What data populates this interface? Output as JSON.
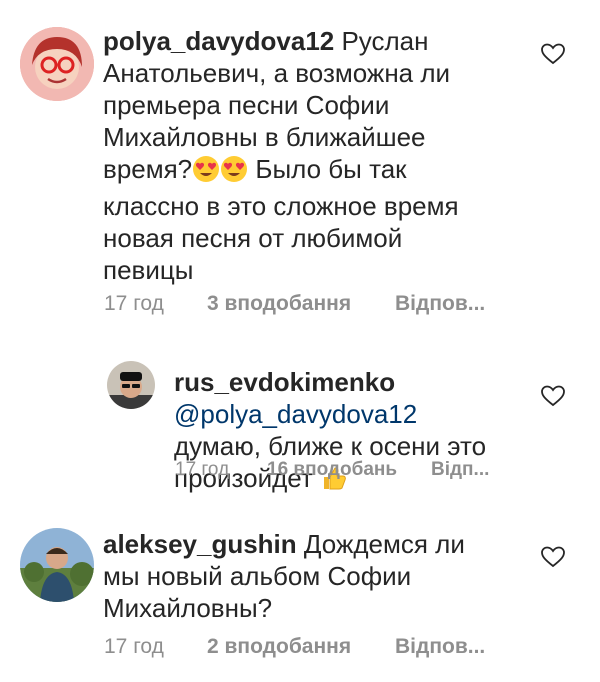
{
  "comments": [
    {
      "username": "polya_davydova12",
      "text_before": " Руслан Анатольевич,  а возможна ли премьера песни Софии Михайловны в ближайшее время?",
      "emoji": "heart-eyes-emoji heart-eyes-emoji",
      "text_after": " Было бы так классно в это сложное время новая песня от любимой певицы",
      "time": "17 год",
      "likes": "3 вподобання",
      "reply": "Відпов..."
    },
    {
      "username": "rus_evdokimenko",
      "mention": "@polya_davydova12",
      "text": " думаю, ближе к осени это произойдет ",
      "emoji": "thumbs-up-emoji",
      "time": "17 год",
      "likes": "16 вподобань",
      "reply": "Відп..."
    },
    {
      "username": "aleksey_gushin",
      "text": " Дождемся ли мы новый альбом Софии Михайловны?",
      "time": "17 год",
      "likes": "2 вподобання",
      "reply": "Відпов..."
    }
  ],
  "icons": {
    "like": "heart-outline-icon",
    "avatar": "avatar"
  },
  "colors": {
    "text": "#262626",
    "meta": "#8e8e8e",
    "mention": "#00376b",
    "heart": "#262626"
  }
}
